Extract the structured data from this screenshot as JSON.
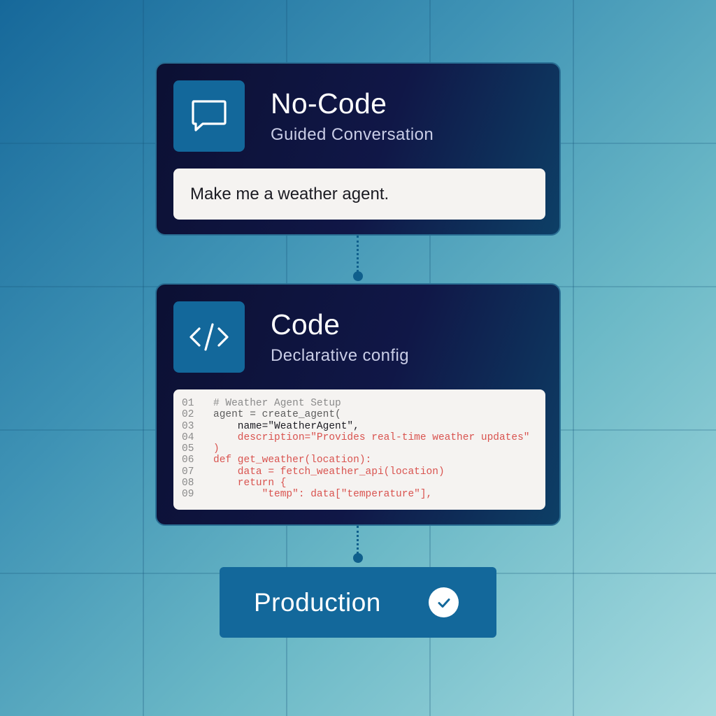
{
  "nocode_card": {
    "title": "No-Code",
    "subtitle": "Guided Conversation",
    "icon": "chat-bubble-icon",
    "prompt": "Make me a weather agent."
  },
  "code_card": {
    "title": "Code",
    "subtitle": "Declarative config",
    "icon": "code-brackets-icon",
    "code_lines": [
      {
        "num": "01",
        "text": "# Weather Agent Setup",
        "color": "comment"
      },
      {
        "num": "02",
        "text": "agent = create_agent(",
        "color": "default"
      },
      {
        "num": "03",
        "text": "    name=\"WeatherAgent\",",
        "color": "dark"
      },
      {
        "num": "04",
        "text": "    description=\"Provides real-time weather updates\"",
        "color": "red"
      },
      {
        "num": "05",
        "text": ")",
        "color": "red"
      },
      {
        "num": "06",
        "text": "def get_weather(location):",
        "color": "red"
      },
      {
        "num": "07",
        "text": "    data = fetch_weather_api(location)",
        "color": "red"
      },
      {
        "num": "08",
        "text": "    return {",
        "color": "red"
      },
      {
        "num": "09",
        "text": "        \"temp\": data[\"temperature\"],",
        "color": "red"
      }
    ]
  },
  "production": {
    "label": "Production",
    "icon": "check-circle-icon"
  },
  "colors": {
    "card_bg": "#0c1033",
    "accent_blue": "#13689b",
    "code_red": "#d9534f",
    "panel_bg": "#f5f3f1"
  }
}
